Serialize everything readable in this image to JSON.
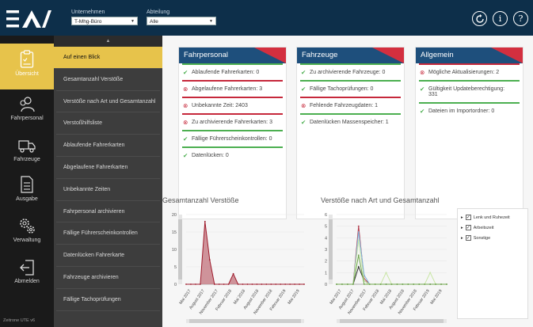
{
  "header": {
    "company_label": "Unternehmen",
    "company_value": "T-Mhg-Büro",
    "department_label": "Abteilung",
    "department_value": "Alle"
  },
  "nav": {
    "items": [
      {
        "label": "Übersicht",
        "icon": "clipboard-icon"
      },
      {
        "label": "Fahrpersonal",
        "icon": "users-icon"
      },
      {
        "label": "Fahrzeuge",
        "icon": "truck-icon"
      },
      {
        "label": "Ausgabe",
        "icon": "document-icon"
      },
      {
        "label": "Verwaltung",
        "icon": "gears-icon"
      },
      {
        "label": "Abmelden",
        "icon": "logout-icon"
      }
    ],
    "version": "Zeitrone UTE v6"
  },
  "submenu": [
    "Auf einen Blick",
    "Gesamtanzahl Verstöße",
    "Verstöße nach Art und Gesamtanzahl",
    "Verstoßhilfsliste",
    "Ablaufende Fahrerkarten",
    "Abgelaufene Fahrerkarten",
    "Unbekannte Zeiten",
    "Fahrpersonal archivieren",
    "Fällige Führerscheinkontrollen",
    "Datenlücken Fahrerkarte",
    "Fahrzeuge archivieren",
    "Fällige Tachoprüfungen"
  ],
  "cards": {
    "fahrpersonal": {
      "title": "Fahrpersonal",
      "rows": [
        {
          "text": "Ablaufende Fahrerkarten:",
          "value": "0",
          "status": "ok"
        },
        {
          "text": "Abgelaufene Fahrerkarten:",
          "value": "3",
          "status": "error"
        },
        {
          "text": "Unbekannte Zeit:",
          "value": "2403",
          "status": "error"
        },
        {
          "text": "Zu archivierende Fahrerkarten:",
          "value": "3",
          "status": "error"
        },
        {
          "text": "Fällige Führerscheinkontrollen:",
          "value": "0",
          "status": "ok"
        },
        {
          "text": "Datenlücken:",
          "value": "0",
          "status": "ok"
        }
      ]
    },
    "fahrzeuge": {
      "title": "Fahrzeuge",
      "rows": [
        {
          "text": "Zu archivierende Fahrzeuge:",
          "value": "0",
          "status": "ok"
        },
        {
          "text": "Fällige Tachoprüfungen:",
          "value": "0",
          "status": "ok"
        },
        {
          "text": "Fehlende Fahrzeugdaten:",
          "value": "1",
          "status": "error"
        },
        {
          "text": "Datenlücken Massenspeicher:",
          "value": "1",
          "status": "ok"
        }
      ]
    },
    "allgemein": {
      "title": "Allgemein",
      "rows": [
        {
          "text": "Mögliche Aktualisierungen:",
          "value": "2",
          "status": "error"
        },
        {
          "text": "Gültigkeit Updateberechtigung:",
          "value": "331",
          "status": "ok"
        },
        {
          "text": "Dateien im Importordner:",
          "value": "0",
          "status": "ok"
        }
      ]
    }
  },
  "charts": {
    "left_title": "Gesamtanzahl Verstöße",
    "right_title": "Verstöße nach Art und Gesamtanzahl",
    "legend": [
      "Lenk und Ruhezeit",
      "Arbeitszeit",
      "Sonstige"
    ]
  },
  "chart_data": [
    {
      "type": "area",
      "title": "Gesamtanzahl Verstöße",
      "categories": [
        "Mai 2017",
        "August 2017",
        "November 2017",
        "Februar 2018",
        "Mai 2018",
        "August 2018",
        "November 2018",
        "Februar 2019",
        "Mai 2019"
      ],
      "ylim": [
        0,
        20
      ],
      "yticks": [
        0,
        5,
        10,
        15,
        20
      ],
      "values": [
        0,
        0,
        0,
        0,
        18,
        7,
        0,
        0,
        0,
        0,
        3,
        0,
        0,
        0,
        0,
        0,
        0,
        0,
        0,
        0,
        0,
        0,
        0,
        0,
        0,
        0
      ],
      "colors": {
        "line": "#9e1b2c",
        "fill": "#c8818a"
      }
    },
    {
      "type": "line",
      "title": "Verstöße nach Art und Gesamtanzahl",
      "categories": [
        "Mai 2017",
        "August 2017",
        "November 2017",
        "Februar 2018",
        "Mai 2018",
        "August 2018",
        "November 2018",
        "Februar 2019",
        "Mai 2019"
      ],
      "ylim": [
        0,
        6
      ],
      "yticks": [
        0,
        1,
        2,
        3,
        4,
        5,
        6
      ],
      "series": [
        {
          "name": "Lenk und Ruhezeit",
          "color": "#2d2d2d",
          "values": [
            0,
            0,
            0,
            0,
            1.5,
            0.3,
            0,
            0,
            0,
            0,
            0,
            0,
            0,
            0,
            0,
            0,
            0,
            0,
            0,
            0,
            0
          ]
        },
        {
          "name": "Arbeitszeit",
          "color": "#b33a4b",
          "values": [
            0,
            0,
            0,
            0,
            5,
            0.5,
            0,
            0,
            0,
            0,
            0,
            0,
            0,
            0,
            0,
            0,
            0,
            0,
            0,
            0,
            0
          ]
        },
        {
          "name": "Sonstige",
          "color": "#7fb7e0",
          "values": [
            0,
            0,
            0,
            0,
            4.5,
            0.8,
            0,
            0,
            0,
            0,
            0,
            0,
            0,
            0,
            0,
            0,
            0,
            0,
            0,
            0,
            0
          ]
        },
        {
          "name": "",
          "color": "#c9e6a6",
          "values": [
            0,
            0,
            0,
            0,
            3.8,
            0.3,
            0,
            0,
            0,
            1,
            0,
            0,
            0,
            0,
            0,
            0,
            0,
            1,
            0,
            0,
            0
          ]
        },
        {
          "name": "",
          "color": "#6fa84a",
          "values": [
            0,
            0,
            0,
            0,
            2.5,
            0,
            0,
            0,
            0,
            0,
            0,
            0,
            0,
            0,
            0,
            0,
            0,
            0,
            0,
            0,
            0
          ]
        }
      ]
    }
  ]
}
